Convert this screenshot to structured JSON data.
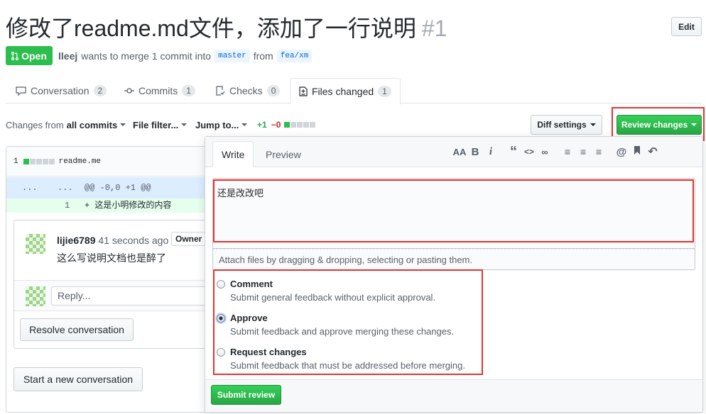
{
  "pr": {
    "title": "修改了readme.md文件，添加了一行说明",
    "number": "#1",
    "edit_label": "Edit",
    "state": "Open",
    "author": "lleej",
    "merge_text": "wants to merge 1 commit into",
    "base_branch": "master",
    "from_text": "from",
    "head_branch": "fea/xm"
  },
  "tabs": [
    {
      "label": "Conversation",
      "count": "2"
    },
    {
      "label": "Commits",
      "count": "1"
    },
    {
      "label": "Checks",
      "count": "0"
    },
    {
      "label": "Files changed",
      "count": "1"
    }
  ],
  "toolbar": {
    "changes_from_prefix": "Changes from",
    "changes_from_value": "all commits",
    "file_filter": "File filter...",
    "jump_to": "Jump to...",
    "additions": "+1",
    "deletions": "−0",
    "diff_settings": "Diff settings",
    "review_changes": "Review changes"
  },
  "file": {
    "count": "1",
    "name": "readme.me",
    "hunk_left": "...",
    "hunk_right": "...",
    "hunk_header": "@@ -0,0 +1 @@",
    "line_number": "1",
    "line_content": "+  这是小明修改的内容"
  },
  "comment": {
    "author": "lijie6789",
    "time": "41 seconds ago",
    "badge": "Owner",
    "body": "这么写说明文档也是醉了",
    "reply_placeholder": "Reply...",
    "resolve_label": "Resolve conversation",
    "new_conversation_label": "Start a new conversation"
  },
  "review": {
    "write_tab": "Write",
    "preview_tab": "Preview",
    "text": "还是改改吧",
    "attach_hint": "Attach files by dragging & dropping, selecting or pasting them.",
    "options": [
      {
        "title": "Comment",
        "desc": "Submit general feedback without explicit approval.",
        "checked": false
      },
      {
        "title": "Approve",
        "desc": "Submit feedback and approve merging these changes.",
        "checked": true
      },
      {
        "title": "Request changes",
        "desc": "Submit feedback that must be addressed before merging.",
        "checked": false
      }
    ],
    "submit_label": "Submit review",
    "toolbar_icons": [
      "text-size-icon",
      "bold-icon",
      "italic-icon",
      "quote-icon",
      "code-icon",
      "link-icon",
      "unordered-list-icon",
      "ordered-list-icon",
      "task-list-icon",
      "mention-icon",
      "bookmark-icon",
      "reply-icon"
    ]
  },
  "colors": {
    "accent_green": "#2cbe4e",
    "annotation_red": "#e3342f",
    "link_blue": "#0366d6"
  }
}
